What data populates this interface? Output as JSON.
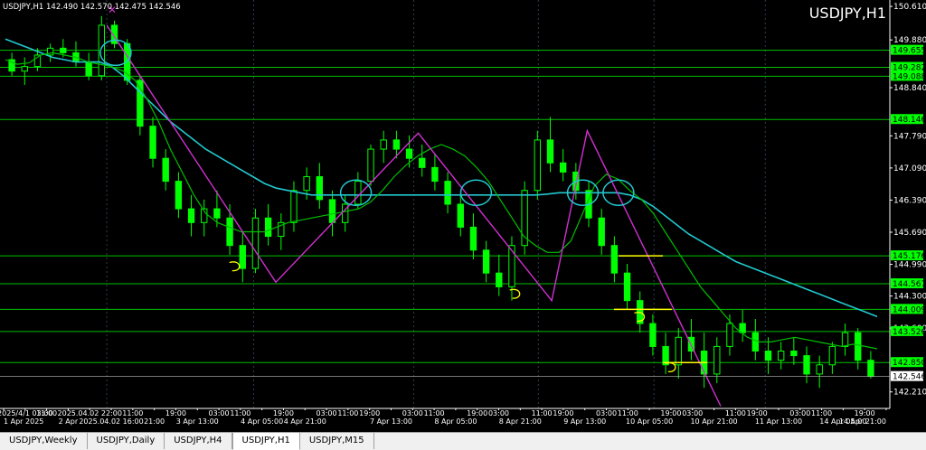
{
  "colors": {
    "background": "#000000",
    "grid": "#2c3e50",
    "candle": "#00ff00",
    "fast_ma": "#00c000",
    "slow_ma": "#22c8d0",
    "zigzag": "#d030d0",
    "hline": "#00ff00",
    "marker_yellow": "#ffff00",
    "circle": "#22c8d0",
    "axis_text": "#ffffff",
    "price_label_bg": "#00ff00",
    "current_label_bg": "#ffffff"
  },
  "header": {
    "info_line": "USDJPY,H1  142.490 142.570 142.475 142.546",
    "symbol_title": "USDJPY,H1"
  },
  "crosshair_labels": {
    "time_top": "2025.04.02 22:00",
    "time_bottom": "2025.04.02 16:00"
  },
  "chart_data": {
    "type": "candlestick",
    "symbol": "USDJPY",
    "timeframe": "H1",
    "ylim": [
      141.85,
      150.75
    ],
    "y_ticks": [
      150.61,
      149.88,
      148.84,
      147.79,
      147.09,
      146.39,
      145.69,
      144.99,
      144.3,
      143.6,
      142.21
    ],
    "y_ticks_display": [
      "150.610",
      "149.880",
      "148.840",
      "147.790",
      "147.090",
      "146.390",
      "145.690",
      "144.990",
      "144.300",
      "143.600",
      "142.210"
    ],
    "x_ticks": [
      "1 Apr 2025",
      "2025/4/1 03:00",
      "11:00",
      "2 Apr",
      "22:00",
      "3 Apr 13:00",
      "19:00",
      "03:00",
      "11:00",
      "19:00",
      "4 Apr 05:00",
      "13:00",
      "21:00",
      "4 Apr 21:00",
      "7 Apr 13:00",
      "19:00",
      "03:00",
      "11:00",
      "8 Apr 05:00",
      "13:00",
      "8 Apr 21:00",
      "05:00",
      "9 Apr 13:00",
      "19:00",
      "03:00",
      "10 Apr 05:00",
      "11:00",
      "19:00",
      "10 Apr 21:00",
      "05:00",
      "11 Apr 13:00",
      "19:00",
      "03:00",
      "14 Apr 05:00",
      "11:00",
      "19:00",
      "14 Apr 21:00"
    ],
    "x_tick_labels": [
      {
        "label": "1 Apr 2025",
        "row": 2
      },
      {
        "label": "2025/4/1 03:00",
        "row": 1
      },
      {
        "label": "11:00",
        "row": 1
      },
      {
        "label": "2 Apr",
        "row": 2
      },
      {
        "label": "2025.04.02 22:00",
        "row": 1
      },
      {
        "label": "2025.04.02 16:00",
        "row": 2
      },
      {
        "label": "11:00",
        "row": 1
      },
      {
        "label": "21:00",
        "row": 2
      },
      {
        "label": "19:00",
        "row": 1
      },
      {
        "label": "3 Apr 13:00",
        "row": 2
      },
      {
        "label": "03:00",
        "row": 1
      },
      {
        "label": "11:00",
        "row": 1
      },
      {
        "label": "4 Apr 05:00",
        "row": 2
      },
      {
        "label": "19:00",
        "row": 1
      },
      {
        "label": "4 Apr 21:00",
        "row": 2
      },
      {
        "label": "03:00",
        "row": 1
      },
      {
        "label": "11:00",
        "row": 1
      },
      {
        "label": "19:00",
        "row": 1
      },
      {
        "label": "7 Apr 13:00",
        "row": 2
      },
      {
        "label": "03:00",
        "row": 1
      },
      {
        "label": "11:00",
        "row": 1
      },
      {
        "label": "8 Apr 05:00",
        "row": 2
      },
      {
        "label": "19:00",
        "row": 1
      },
      {
        "label": "03:00",
        "row": 1
      },
      {
        "label": "8 Apr 21:00",
        "row": 2
      },
      {
        "label": "11:00",
        "row": 1
      },
      {
        "label": "19:00",
        "row": 1
      },
      {
        "label": "9 Apr 13:00",
        "row": 2
      },
      {
        "label": "03:00",
        "row": 1
      },
      {
        "label": "11:00",
        "row": 1
      },
      {
        "label": "10 Apr 05:00",
        "row": 2
      },
      {
        "label": "19:00",
        "row": 1
      },
      {
        "label": "03:00",
        "row": 1
      },
      {
        "label": "10 Apr 21:00",
        "row": 2
      },
      {
        "label": "11:00",
        "row": 1
      },
      {
        "label": "19:00",
        "row": 1
      },
      {
        "label": "11 Apr 13:00",
        "row": 2
      },
      {
        "label": "03:00",
        "row": 1
      },
      {
        "label": "11:00",
        "row": 1
      },
      {
        "label": "14 Apr 05:00",
        "row": 2
      },
      {
        "label": "19:00",
        "row": 1
      },
      {
        "label": "14 Apr 21:00",
        "row": 2
      }
    ],
    "horizontal_levels": [
      149.655,
      149.282,
      149.088,
      148.146,
      145.176,
      144.567,
      144.009,
      143.526,
      142.85
    ],
    "horizontal_level_labels": [
      "149.655",
      "149.282",
      "149.088",
      "148.146",
      "145.176",
      "144.567",
      "144.009",
      "143.526",
      "142.850"
    ],
    "current_price": 142.546,
    "current_price_label": "142.546",
    "zigzag": [
      {
        "i": 0.12,
        "price": 150.2
      },
      {
        "i": 0.31,
        "price": 144.6
      },
      {
        "i": 0.47,
        "price": 147.85
      },
      {
        "i": 0.62,
        "price": 144.2
      },
      {
        "i": 0.66,
        "price": 147.9
      },
      {
        "i": 0.81,
        "price": 141.9
      }
    ],
    "ma_fast": [
      149.45,
      149.35,
      149.38,
      149.55,
      149.6,
      149.55,
      149.5,
      149.4,
      149.35,
      149.3,
      149.2,
      149.0,
      148.6,
      148.1,
      147.5,
      147.0,
      146.5,
      146.1,
      145.9,
      145.8,
      145.7,
      145.7,
      145.7,
      145.8,
      145.9,
      145.95,
      146.0,
      146.05,
      146.1,
      146.15,
      146.2,
      146.35,
      146.6,
      146.9,
      147.15,
      147.35,
      147.5,
      147.6,
      147.5,
      147.35,
      147.1,
      146.8,
      146.4,
      146.0,
      145.6,
      145.4,
      145.25,
      145.25,
      145.5,
      146.1,
      146.7,
      146.95,
      146.85,
      146.6,
      146.4,
      146.1,
      145.7,
      145.3,
      144.9,
      144.5,
      144.2,
      143.9,
      143.6,
      143.4,
      143.3,
      143.3,
      143.35,
      143.4,
      143.35,
      143.3,
      143.25,
      143.2,
      143.25,
      143.2,
      143.15
    ],
    "ma_slow": [
      149.9,
      149.8,
      149.7,
      149.6,
      149.5,
      149.45,
      149.4,
      149.4,
      149.4,
      149.3,
      149.1,
      148.85,
      148.6,
      148.35,
      148.1,
      147.9,
      147.7,
      147.5,
      147.35,
      147.2,
      147.05,
      146.9,
      146.75,
      146.65,
      146.6,
      146.55,
      146.5,
      146.5,
      146.5,
      146.5,
      146.5,
      146.5,
      146.5,
      146.5,
      146.5,
      146.5,
      146.5,
      146.5,
      146.5,
      146.5,
      146.5,
      146.5,
      146.5,
      146.5,
      146.5,
      146.5,
      146.52,
      146.55,
      146.55,
      146.55,
      146.55,
      146.55,
      146.55,
      146.5,
      146.4,
      146.25,
      146.05,
      145.85,
      145.65,
      145.5,
      145.35,
      145.2,
      145.05,
      144.95,
      144.85,
      144.75,
      144.65,
      144.55,
      144.45,
      144.35,
      144.25,
      144.15,
      144.05,
      143.95,
      143.85
    ],
    "candles": [
      [
        149.45,
        149.6,
        149.1,
        149.2
      ],
      [
        149.2,
        149.5,
        148.9,
        149.3
      ],
      [
        149.3,
        149.7,
        149.2,
        149.55
      ],
      [
        149.55,
        149.8,
        149.4,
        149.7
      ],
      [
        149.7,
        149.9,
        149.5,
        149.6
      ],
      [
        149.6,
        149.85,
        149.3,
        149.4
      ],
      [
        149.4,
        149.6,
        149.0,
        149.1
      ],
      [
        149.1,
        150.4,
        149.0,
        150.2
      ],
      [
        150.2,
        150.3,
        149.7,
        149.8
      ],
      [
        149.8,
        149.9,
        148.9,
        149.0
      ],
      [
        149.0,
        149.1,
        147.8,
        148.0
      ],
      [
        148.0,
        148.2,
        147.1,
        147.3
      ],
      [
        147.3,
        147.5,
        146.6,
        146.8
      ],
      [
        146.8,
        147.0,
        146.0,
        146.2
      ],
      [
        146.2,
        146.5,
        145.6,
        145.9
      ],
      [
        145.9,
        146.4,
        145.6,
        146.2
      ],
      [
        146.2,
        146.6,
        145.8,
        146.0
      ],
      [
        146.0,
        146.3,
        145.2,
        145.4
      ],
      [
        145.4,
        145.7,
        144.6,
        144.9
      ],
      [
        144.9,
        146.2,
        144.8,
        146.0
      ],
      [
        146.0,
        146.3,
        145.4,
        145.6
      ],
      [
        145.6,
        146.1,
        145.3,
        145.9
      ],
      [
        145.9,
        146.8,
        145.7,
        146.6
      ],
      [
        146.6,
        147.1,
        146.4,
        146.9
      ],
      [
        146.9,
        147.2,
        146.2,
        146.4
      ],
      [
        146.4,
        146.6,
        145.6,
        145.9
      ],
      [
        145.9,
        146.5,
        145.7,
        146.3
      ],
      [
        146.3,
        147.0,
        146.2,
        146.8
      ],
      [
        146.8,
        147.6,
        146.7,
        147.5
      ],
      [
        147.5,
        147.9,
        147.2,
        147.7
      ],
      [
        147.7,
        147.9,
        147.3,
        147.5
      ],
      [
        147.5,
        147.8,
        147.1,
        147.3
      ],
      [
        147.3,
        147.6,
        146.9,
        147.1
      ],
      [
        147.1,
        147.4,
        146.6,
        146.8
      ],
      [
        146.8,
        147.0,
        146.1,
        146.3
      ],
      [
        146.3,
        146.5,
        145.6,
        145.8
      ],
      [
        145.8,
        146.1,
        145.1,
        145.3
      ],
      [
        145.3,
        145.5,
        144.6,
        144.8
      ],
      [
        144.8,
        145.2,
        144.3,
        144.5
      ],
      [
        144.5,
        145.6,
        144.2,
        145.4
      ],
      [
        145.4,
        146.8,
        145.2,
        146.6
      ],
      [
        146.6,
        147.9,
        146.4,
        147.7
      ],
      [
        147.7,
        148.2,
        147.0,
        147.2
      ],
      [
        147.2,
        147.5,
        146.8,
        147.0
      ],
      [
        147.0,
        147.2,
        146.4,
        146.6
      ],
      [
        146.6,
        146.8,
        145.8,
        146.0
      ],
      [
        146.0,
        146.2,
        145.2,
        145.4
      ],
      [
        145.4,
        145.6,
        144.6,
        144.8
      ],
      [
        144.8,
        145.0,
        144.0,
        144.2
      ],
      [
        144.2,
        144.4,
        143.5,
        143.7
      ],
      [
        143.7,
        143.9,
        143.0,
        143.2
      ],
      [
        143.2,
        143.5,
        142.6,
        142.8
      ],
      [
        142.8,
        143.6,
        142.5,
        143.4
      ],
      [
        143.4,
        143.8,
        142.9,
        143.1
      ],
      [
        143.1,
        143.5,
        142.3,
        142.6
      ],
      [
        142.6,
        143.4,
        142.4,
        143.2
      ],
      [
        143.2,
        143.9,
        143.0,
        143.7
      ],
      [
        143.7,
        144.0,
        143.3,
        143.5
      ],
      [
        143.5,
        143.8,
        142.9,
        143.1
      ],
      [
        143.1,
        143.4,
        142.6,
        142.9
      ],
      [
        142.9,
        143.3,
        142.7,
        143.1
      ],
      [
        143.1,
        143.4,
        142.8,
        143.0
      ],
      [
        143.0,
        143.2,
        142.4,
        142.6
      ],
      [
        142.6,
        143.0,
        142.3,
        142.8
      ],
      [
        142.8,
        143.3,
        142.6,
        143.2
      ],
      [
        143.2,
        143.7,
        143.0,
        143.5
      ],
      [
        143.5,
        143.6,
        142.7,
        142.9
      ],
      [
        142.9,
        143.1,
        142.5,
        142.55
      ]
    ]
  },
  "annotations": {
    "circles": [
      {
        "i": 0.13,
        "price": 149.6
      },
      {
        "i": 0.4,
        "price": 146.55
      },
      {
        "i": 0.535,
        "price": 146.55
      },
      {
        "i": 0.655,
        "price": 146.55
      },
      {
        "i": 0.695,
        "price": 146.55
      }
    ],
    "yellow_lines": [
      {
        "i0": 0.695,
        "i1": 0.745,
        "price": 145.176
      },
      {
        "i0": 0.69,
        "i1": 0.755,
        "price": 144.009
      },
      {
        "i0": 0.745,
        "i1": 0.795,
        "price": 142.85
      }
    ],
    "yellow_marks": [
      {
        "i": 0.265,
        "price": 144.95
      },
      {
        "i": 0.58,
        "price": 144.35
      },
      {
        "i": 0.72,
        "price": 143.85
      },
      {
        "i": 0.755,
        "price": 142.75
      }
    ]
  },
  "tabs": [
    {
      "label": "USDJPY,Weekly",
      "active": false
    },
    {
      "label": "USDJPY,Daily",
      "active": false
    },
    {
      "label": "USDJPY,H4",
      "active": false
    },
    {
      "label": "USDJPY,H1",
      "active": true
    },
    {
      "label": "USDJPY,M15",
      "active": false
    }
  ]
}
